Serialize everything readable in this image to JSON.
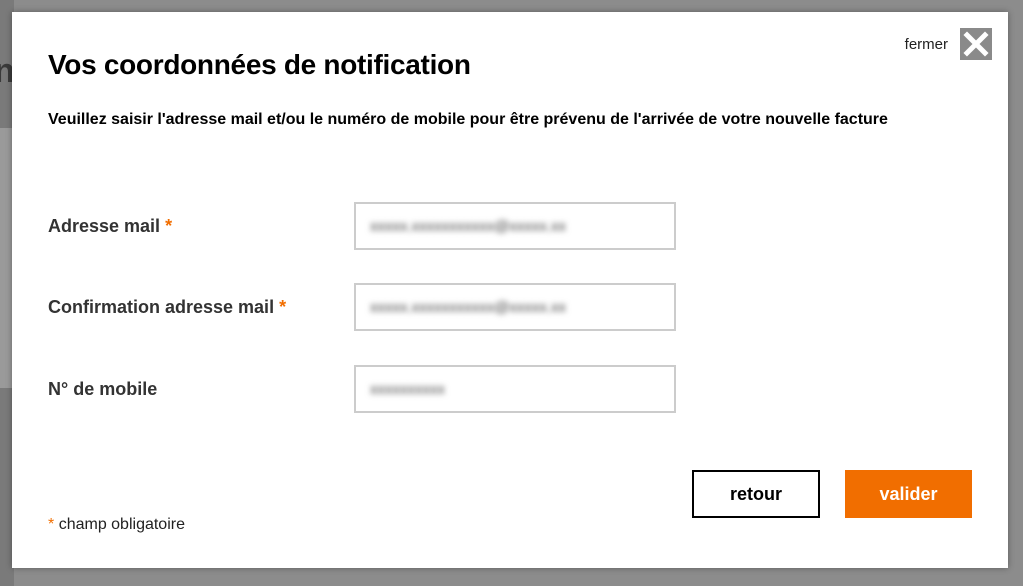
{
  "backdrop": {
    "letter": "n"
  },
  "modal": {
    "close_label": "fermer",
    "title": "Vos coordonnées de notification",
    "subtitle": "Veuillez saisir l'adresse mail et/ou le numéro de mobile pour être prévenu de l'arrivée de votre nouvelle facture",
    "fields": [
      {
        "label": "Adresse mail",
        "required": "*",
        "value": "xxxxx.xxxxxxxxxxx@xxxxx.xx"
      },
      {
        "label": "Confirmation adresse mail",
        "required": "*",
        "value": "xxxxx.xxxxxxxxxxx@xxxxx.xx"
      },
      {
        "label": "N° de mobile",
        "required": "",
        "value": "xxxxxxxxxx"
      }
    ],
    "buttons": {
      "back": "retour",
      "submit": "valider"
    },
    "footnote": {
      "star": "*",
      "text": "champ obligatoire"
    },
    "colors": {
      "accent": "#f16e00",
      "close_bg": "#8a8a8a",
      "border": "#cccccc"
    }
  }
}
